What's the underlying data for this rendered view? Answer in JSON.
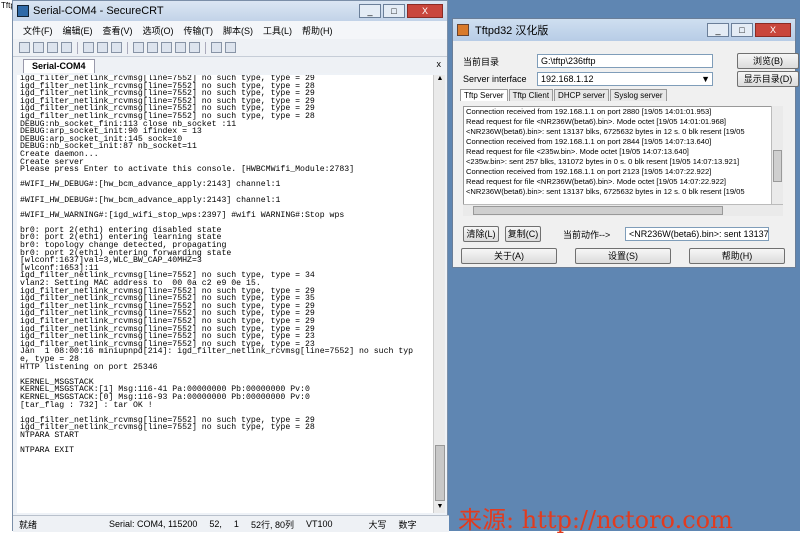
{
  "desktop": {
    "left_edge_text": "Tftp"
  },
  "crt": {
    "title": "Serial-COM4 - SecureCRT",
    "window_buttons": [
      "_",
      "□",
      "X"
    ],
    "menu": [
      "文件(F)",
      "编辑(E)",
      "查看(V)",
      "选项(O)",
      "传输(T)",
      "脚本(S)",
      "工具(L)",
      "帮助(H)"
    ],
    "tab": "Serial-COM4",
    "tab_close": "x",
    "terminal": [
      "igd_filter_netlink_rcvmsg[line=7552] no such type, type = 29",
      "igd_filter_netlink_rcvmsg[line=7552] no such type, type = 28",
      "igd_filter_netlink_rcvmsg[line=7552] no such type, type = 29",
      "igd_filter_netlink_rcvmsg[line=7552] no such type, type = 29",
      "igd_filter_netlink_rcvmsg[line=7552] no such type, type = 29",
      "igd_filter_netlink_rcvmsg[line=7552] no such type, type = 28",
      "DEBUG:nb_socket_fini:113 close nb_socket :11",
      "DEBUG:arp_socket_init:90 ifindex = 13",
      "DEBUG:arp_socket_init:145 sock=10",
      "DEBUG:nb_socket_init:87 nb_socket=11",
      "Create daemon...",
      "Create server",
      "Please press Enter to activate this console. [HWBCMWifi_Module:2783]",
      "",
      "#WIFI_HW_DEBUG#:[hw_bcm_advance_apply:2143] channel:1",
      "",
      "#WIFI_HW_DEBUG#:[hw_bcm_advance_apply:2143] channel:1",
      "",
      "#WIFI_HW_WARNING#:[igd_wifi_stop_wps:2397] #wifi WARNING#:Stop wps",
      "",
      "br0: port 2(eth1) entering disabled state",
      "br0: port 2(eth1) entering learning state",
      "br0: topology change detected, propagating",
      "br0: port 2(eth1) entering forwarding state",
      "[wlconf:1637]val=3,WLC_BW_CAP_40MHZ=3",
      "[wlconf:1653]:11",
      "igd_filter_netlink_rcvmsg[line=7552] no such type, type = 34",
      "vlan2: Setting MAC address to  00 0a c2 e9 0e 15.",
      "igd_filter_netlink_rcvmsg[line=7552] no such type, type = 29",
      "igd_filter_netlink_rcvmsg[line=7552] no such type, type = 35",
      "igd_filter_netlink_rcvmsg[line=7552] no such type, type = 29",
      "igd_filter_netlink_rcvmsg[line=7552] no such type, type = 29",
      "igd_filter_netlink_rcvmsg[line=7552] no such type, type = 29",
      "igd_filter_netlink_rcvmsg[line=7552] no such type, type = 29",
      "igd_filter_netlink_rcvmsg[line=7552] no such type, type = 23",
      "igd_filter_netlink_rcvmsg[line=7552] no such type, type = 23",
      "Jan  1 08:00:16 miniupnpd[214]: igd_filter_netlink_rcvmsg[line=7552] no such typ",
      "e, type = 28",
      "HTTP listening on port 25346",
      "",
      "KERNEL_MSGSTACK",
      "KERNEL_MSGSTACK:[1] Msg:116-41 Pa:00000000 Pb:00000000 Pv:0",
      "KERNEL_MSGSTACK:[0] Msg:116-93 Pa:00000000 Pb:00000000 Pv:0",
      "[tar_flag : 732] : tar OK !",
      "",
      "igd_filter_netlink_rcvmsg[line=7552] no such type, type = 29",
      "igd_filter_netlink_rcvmsg[line=7552] no such type, type = 28",
      "NTPARA START",
      "",
      "NTPARA EXIT"
    ],
    "status": {
      "ready": "就绪",
      "port": "Serial: COM4, 115200",
      "pos1": "52,",
      "pos2": "1",
      "size": "52行, 80列",
      "term": "VT100",
      "caps": "大写",
      "num": "数字"
    }
  },
  "tftp": {
    "title": "Tftpd32 汉化版",
    "window_buttons": [
      "_",
      "□",
      "X"
    ],
    "dir_label": "当前目录",
    "dir_value": "G:\\tftp\\236tftp",
    "browse": "浏览(B)",
    "iface_label": "Server interface",
    "iface_value": "192.168.1.12",
    "show_dir": "显示目录(D)",
    "tabs": [
      "Tftp Server",
      "Tftp Client",
      "DHCP server",
      "Syslog server"
    ],
    "log": [
      "Connection received from 192.168.1.1 on port 2880 [19/05 14:01:01.953]",
      "Read request for file <NR236W(beta6).bin>. Mode octet [19/05 14:01:01.968]",
      "<NR236W(beta6).bin>: sent 13137 blks, 6725632 bytes in 12 s. 0 blk resent [19/05",
      "Connection received from 192.168.1.1 on port 2844 [19/05 14:07:13.640]",
      "Read request for file <235w.bin>. Mode octet [19/05 14:07:13.640]",
      "<235w.bin>: sent 257 blks, 131072 bytes in 0 s. 0 blk resent [19/05 14:07:13.921]",
      "Connection received from 192.168.1.1 on port 2123 [19/05 14:07:22.922]",
      "Read request for file <NR236W(beta6).bin>. Mode octet [19/05 14:07:22.922]",
      "<NR236W(beta6).bin>: sent 13137 blks, 6725632 bytes in 12 s. 0 blk resent [19/05"
    ],
    "clear": "清除(L)",
    "copy": "复制(C)",
    "current_action_label": "当前动作-->",
    "current_action": "<NR236W(beta6).bin>: sent 13137 blk",
    "about": "关于(A)",
    "settings": "设置(S)",
    "help": "帮助(H)"
  },
  "watermark": "来源: http://nctoro.com"
}
